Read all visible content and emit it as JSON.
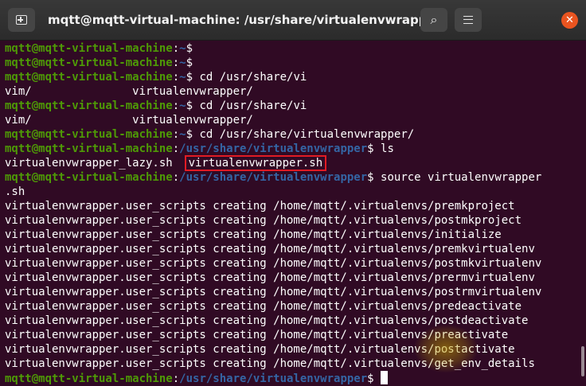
{
  "window": {
    "title": "mqtt@mqtt-virtual-machine: /usr/share/virtualenvwrapper",
    "icons": {
      "new_tab": "new-tab-icon",
      "search": "search-icon",
      "menu": "hamburger-menu-icon",
      "close": "close-icon"
    },
    "close_glyph": "✕",
    "search_glyph": "⌕"
  },
  "colors": {
    "background": "#300a24",
    "prompt_user": "#4e9a06",
    "prompt_path": "#3465a4",
    "text": "#ffffff",
    "highlight_box": "#e01b24",
    "close_button": "#e95420"
  },
  "prompt": {
    "user": "mqtt@mqtt-virtual-machine",
    "colon": ":",
    "home": "~",
    "dollar": "$"
  },
  "terminal": {
    "lines": [
      {
        "kind": "prompt",
        "path": "~",
        "cmd": ""
      },
      {
        "kind": "prompt",
        "path": "~",
        "cmd": ""
      },
      {
        "kind": "prompt",
        "path": "~",
        "cmd": " cd /usr/share/vi"
      },
      {
        "kind": "out",
        "text": "vim/               virtualenvwrapper/"
      },
      {
        "kind": "prompt",
        "path": "~",
        "cmd": " cd /usr/share/vi"
      },
      {
        "kind": "out",
        "text": "vim/               virtualenvwrapper/"
      },
      {
        "kind": "prompt",
        "path": "~",
        "cmd": " cd /usr/share/virtualenvwrapper/"
      },
      {
        "kind": "prompt",
        "path": "/usr/share/virtualenvwrapper",
        "cmd": " ls"
      },
      {
        "kind": "ls",
        "first": "virtualenvwrapper_lazy.sh",
        "gap": "  ",
        "highlighted": "virtualenvwrapper.sh"
      },
      {
        "kind": "prompt",
        "path": "/usr/share/virtualenvwrapper",
        "cmd": " source virtualenvwrapper"
      },
      {
        "kind": "out",
        "text": ".sh"
      },
      {
        "kind": "out",
        "text": "virtualenvwrapper.user_scripts creating /home/mqtt/.virtualenvs/premkproject"
      },
      {
        "kind": "out",
        "text": "virtualenvwrapper.user_scripts creating /home/mqtt/.virtualenvs/postmkproject"
      },
      {
        "kind": "out",
        "text": "virtualenvwrapper.user_scripts creating /home/mqtt/.virtualenvs/initialize"
      },
      {
        "kind": "out",
        "text": "virtualenvwrapper.user_scripts creating /home/mqtt/.virtualenvs/premkvirtualenv"
      },
      {
        "kind": "out",
        "text": "virtualenvwrapper.user_scripts creating /home/mqtt/.virtualenvs/postmkvirtualenv"
      },
      {
        "kind": "out",
        "text": "virtualenvwrapper.user_scripts creating /home/mqtt/.virtualenvs/prermvirtualenv"
      },
      {
        "kind": "out",
        "text": "virtualenvwrapper.user_scripts creating /home/mqtt/.virtualenvs/postrmvirtualenv"
      },
      {
        "kind": "out",
        "text": "virtualenvwrapper.user_scripts creating /home/mqtt/.virtualenvs/predeactivate"
      },
      {
        "kind": "out",
        "text": "virtualenvwrapper.user_scripts creating /home/mqtt/.virtualenvs/postdeactivate"
      },
      {
        "kind": "out",
        "text": "virtualenvwrapper.user_scripts creating /home/mqtt/.virtualenvs/preactivate"
      },
      {
        "kind": "out",
        "text": "virtualenvwrapper.user_scripts creating /home/mqtt/.virtualenvs/postactivate"
      },
      {
        "kind": "out",
        "text": "virtualenvwrapper.user_scripts creating /home/mqtt/.virtualenvs/get_env_details"
      },
      {
        "kind": "prompt",
        "path": "/usr/share/virtualenvwrapper",
        "cmd": " ",
        "cursor": true
      }
    ]
  }
}
